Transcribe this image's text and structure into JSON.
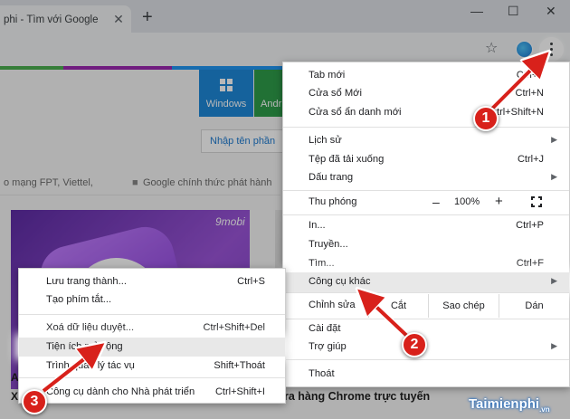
{
  "browser": {
    "tab_title": "phi - Tìm với Google",
    "tab_close": "✕",
    "new_tab": "+",
    "win_min": "—",
    "win_max": "☐",
    "win_close": "✕",
    "star": "☆",
    "profile_color": "#1976d2",
    "accent_stripe": [
      "#4caf50",
      "#9c27b0",
      "#2196f3",
      "#4caf50"
    ]
  },
  "page": {
    "windows_tile": "Windows",
    "android_tile": "Andr",
    "search_placeholder": "Nhập tên phần",
    "news_1": "o mạng FPT, Viettel,",
    "news_2": "Google chính thức phát hành",
    "thumb_brand": "9mobi",
    "article_a": "A",
    "article_x": "X",
    "article_b": "ra hàng Chrome trực tuyến"
  },
  "menu": {
    "new_tab": {
      "label": "Tab mới",
      "shortcut": "Ctrl+T"
    },
    "new_window": {
      "label": "Cửa sổ Mới",
      "shortcut": "Ctrl+N"
    },
    "incognito": {
      "label": "Cửa sổ ẩn danh mới",
      "shortcut": "Ctrl+Shift+N"
    },
    "history": {
      "label": "Lịch sử"
    },
    "downloads": {
      "label": "Tệp đã tải xuống",
      "shortcut": "Ctrl+J"
    },
    "bookmarks": {
      "label": "Dấu trang"
    },
    "zoom": {
      "label": "Thu phóng",
      "minus": "–",
      "value": "100%",
      "plus": "+"
    },
    "print": {
      "label": "In...",
      "shortcut": "Ctrl+P"
    },
    "cast": {
      "label": "Truyền..."
    },
    "find": {
      "label": "Tìm...",
      "shortcut": "Ctrl+F"
    },
    "more_tools": {
      "label": "Công cụ khác"
    },
    "edit": {
      "label": "Chỉnh sửa",
      "cut": "Cắt",
      "copy": "Sao chép",
      "paste": "Dán"
    },
    "settings": {
      "label": "Cài đặt"
    },
    "help": {
      "label": "Trợ giúp"
    },
    "exit": {
      "label": "Thoát"
    }
  },
  "submenu": {
    "save_page": {
      "label": "Lưu trang thành...",
      "shortcut": "Ctrl+S"
    },
    "create_shortcut": {
      "label": "Tạo phím tắt..."
    },
    "clear_data": {
      "label": "Xoá dữ liệu duyệt...",
      "shortcut": "Ctrl+Shift+Del"
    },
    "extensions": {
      "label": "Tiện ích mở rộng"
    },
    "task_manager": {
      "label": "Trình quản lý tác vụ",
      "shortcut": "Shift+Thoát"
    },
    "devtools": {
      "label": "Công cụ dành cho Nhà phát triển",
      "shortcut": "Ctrl+Shift+I"
    }
  },
  "steps": [
    "1",
    "2",
    "3"
  ],
  "watermark": {
    "main": "Taimienphi",
    "suffix": ".vn"
  },
  "colors": {
    "badge": "#d8211b",
    "arrow": "#d8211b"
  }
}
